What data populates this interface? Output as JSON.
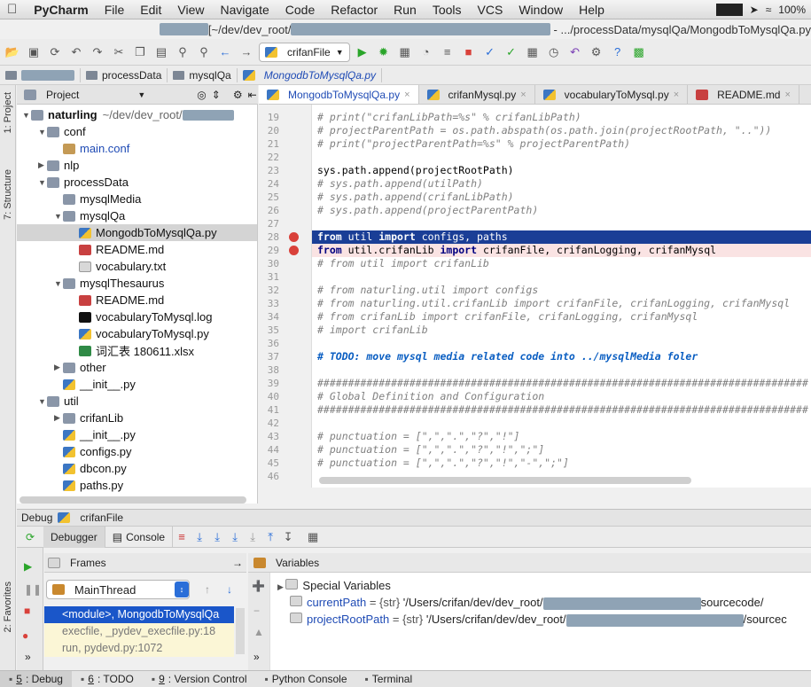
{
  "menu": {
    "apple": "",
    "app": "PyCharm",
    "items": [
      "File",
      "Edit",
      "View",
      "Navigate",
      "Code",
      "Refactor",
      "Run",
      "Tools",
      "VCS",
      "Window",
      "Help"
    ],
    "battery": "100%"
  },
  "window_title": {
    "left": "[~/dev/dev_root/",
    "right": "- .../processData/mysqlQa/MongodbToMysqlQa.py"
  },
  "toolbar": {
    "run_config": "crifanFile"
  },
  "breadcrumbs": [
    "processData",
    "mysqlQa",
    "MongodbToMysqlQa.py"
  ],
  "sidebar": {
    "project_tab": "1: Project",
    "structure_tab": "7: Structure",
    "favorites_tab": "2: Favorites"
  },
  "project_panel": {
    "title": "Project"
  },
  "tree": [
    {
      "label": "naturling",
      "extra": "~/dev/dev_root/",
      "depth": 0,
      "arrow": "▼",
      "icon": "folder",
      "bold": true
    },
    {
      "label": "conf",
      "depth": 1,
      "arrow": "▼",
      "icon": "folder"
    },
    {
      "label": "main.conf",
      "depth": 2,
      "arrow": "",
      "icon": "conf",
      "blue": true
    },
    {
      "label": "nlp",
      "depth": 1,
      "arrow": "▶",
      "icon": "folder"
    },
    {
      "label": "processData",
      "depth": 1,
      "arrow": "▼",
      "icon": "folder"
    },
    {
      "label": "mysqlMedia",
      "depth": 2,
      "arrow": "",
      "icon": "folder"
    },
    {
      "label": "mysqlQa",
      "depth": 2,
      "arrow": "▼",
      "icon": "folder"
    },
    {
      "label": "MongodbToMysqlQa.py",
      "depth": 3,
      "arrow": "",
      "icon": "py",
      "selected": true
    },
    {
      "label": "README.md",
      "depth": 3,
      "arrow": "",
      "icon": "md"
    },
    {
      "label": "vocabulary.txt",
      "depth": 3,
      "arrow": "",
      "icon": "txt"
    },
    {
      "label": "mysqlThesaurus",
      "depth": 2,
      "arrow": "▼",
      "icon": "folder"
    },
    {
      "label": "README.md",
      "depth": 3,
      "arrow": "",
      "icon": "md"
    },
    {
      "label": "vocabularyToMysql.log",
      "depth": 3,
      "arrow": "",
      "icon": "log"
    },
    {
      "label": "vocabularyToMysql.py",
      "depth": 3,
      "arrow": "",
      "icon": "py"
    },
    {
      "label": "词汇表 180611.xlsx",
      "depth": 3,
      "arrow": "",
      "icon": "xls"
    },
    {
      "label": "other",
      "depth": 2,
      "arrow": "▶",
      "icon": "folder"
    },
    {
      "label": "__init__.py",
      "depth": 2,
      "arrow": "",
      "icon": "py"
    },
    {
      "label": "util",
      "depth": 1,
      "arrow": "▼",
      "icon": "folder"
    },
    {
      "label": "crifanLib",
      "depth": 2,
      "arrow": "▶",
      "icon": "folder"
    },
    {
      "label": "__init__.py",
      "depth": 2,
      "arrow": "",
      "icon": "py"
    },
    {
      "label": "configs.py",
      "depth": 2,
      "arrow": "",
      "icon": "py"
    },
    {
      "label": "dbcon.py",
      "depth": 2,
      "arrow": "",
      "icon": "py"
    },
    {
      "label": "paths.py",
      "depth": 2,
      "arrow": "",
      "icon": "py"
    }
  ],
  "editor_tabs": [
    {
      "label": "MongodbToMysqlQa.py",
      "icon": "py",
      "active": true
    },
    {
      "label": "crifanMysql.py",
      "icon": "py"
    },
    {
      "label": "vocabularyToMysql.py",
      "icon": "py"
    },
    {
      "label": "README.md",
      "icon": "md"
    }
  ],
  "code": [
    {
      "n": "19",
      "text": "# print(\"crifanLibPath=%s\" % crifanLibPath)",
      "kind": "cm"
    },
    {
      "n": "20",
      "text": "# projectParentPath = os.path.abspath(os.path.join(projectRootPath, \"..\"))",
      "kind": "cm"
    },
    {
      "n": "21",
      "text": "# print(\"projectParentPath=%s\" % projectParentPath)",
      "kind": "cm"
    },
    {
      "n": "22",
      "text": "",
      "kind": ""
    },
    {
      "n": "23",
      "text": "sys.path.append(projectRootPath)",
      "kind": ""
    },
    {
      "n": "24",
      "text": "# sys.path.append(utilPath)",
      "kind": "cm"
    },
    {
      "n": "25",
      "text": "# sys.path.append(crifanLibPath)",
      "kind": "cm"
    },
    {
      "n": "26",
      "text": "# sys.path.append(projectParentPath)",
      "kind": "cm"
    },
    {
      "n": "27",
      "text": "",
      "kind": ""
    },
    {
      "n": "28",
      "kw1": "from",
      "mid": " util ",
      "kw2": "import",
      "rest": " configs, paths",
      "kind": "hl",
      "bp": true
    },
    {
      "n": "29",
      "kw1": "from",
      "mid": " util.crifanLib ",
      "kw2": "import",
      "rest": " crifanFile, crifanLogging, crifanMysql",
      "kind": "bpl",
      "bp": true
    },
    {
      "n": "30",
      "text": "# from util import crifanLib",
      "kind": "cm"
    },
    {
      "n": "31",
      "text": "",
      "kind": ""
    },
    {
      "n": "32",
      "text": "# from naturling.util import configs",
      "kind": "cm"
    },
    {
      "n": "33",
      "text": "# from naturling.util.crifanLib import crifanFile, crifanLogging, crifanMysql",
      "kind": "cm"
    },
    {
      "n": "34",
      "text": "# from crifanLib import crifanFile, crifanLogging, crifanMysql",
      "kind": "cm"
    },
    {
      "n": "35",
      "text": "# import crifanLib",
      "kind": "cm"
    },
    {
      "n": "36",
      "text": "",
      "kind": ""
    },
    {
      "n": "37",
      "text": "# TODO: move mysql media related code into ../mysqlMedia foler",
      "kind": "todo"
    },
    {
      "n": "38",
      "text": "",
      "kind": ""
    },
    {
      "n": "39",
      "text": "################################################################################",
      "kind": "cm"
    },
    {
      "n": "40",
      "text": "# Global Definition and Configuration",
      "kind": "cm"
    },
    {
      "n": "41",
      "text": "################################################################################",
      "kind": "cm"
    },
    {
      "n": "42",
      "text": "",
      "kind": ""
    },
    {
      "n": "43",
      "text": "# punctuation = [\",\",\".\",\"?\",\"!\"]",
      "kind": "cm"
    },
    {
      "n": "44",
      "text": "# punctuation = [\",\",\".\",\"?\",\"!\",\";\"]",
      "kind": "cm"
    },
    {
      "n": "45",
      "text": "# punctuation = [\",\",\".\",\"?\",\"!\",\"-\",\";\"]",
      "kind": "cm"
    },
    {
      "n": "46",
      "text": "",
      "kind": ""
    }
  ],
  "debug": {
    "label": "Debug",
    "config": "crifanFile",
    "tabs": [
      {
        "label": "Debugger",
        "active": true
      },
      {
        "label": "Console"
      }
    ],
    "frames_title": "Frames",
    "variables_title": "Variables",
    "thread": "MainThread",
    "frames": [
      {
        "label": "<module>, MongodbToMysqlQa",
        "kind": "sel"
      },
      {
        "label": "execfile, _pydev_execfile.py:18",
        "kind": "lib"
      },
      {
        "label": "run, pydevd.py:1072",
        "kind": "lib"
      }
    ],
    "variables": [
      {
        "name": "Special Variables",
        "type": "",
        "value": "",
        "special": true
      },
      {
        "name": "currentPath",
        "type": "{str}",
        "value": "'/Users/crifan/dev/dev_root/",
        "tail": "sourcecode/"
      },
      {
        "name": "projectRootPath",
        "type": "{str}",
        "value": "'/Users/crifan/dev/dev_root/",
        "tail": "/sourcec"
      }
    ]
  },
  "status_tabs": [
    {
      "num": "5",
      "label": ": Debug",
      "active": true
    },
    {
      "num": "6",
      "label": ": TODO"
    },
    {
      "num": "9",
      "label": ": Version Control"
    },
    {
      "num": "",
      "label": "Python Console"
    },
    {
      "num": "",
      "label": "Terminal"
    }
  ]
}
